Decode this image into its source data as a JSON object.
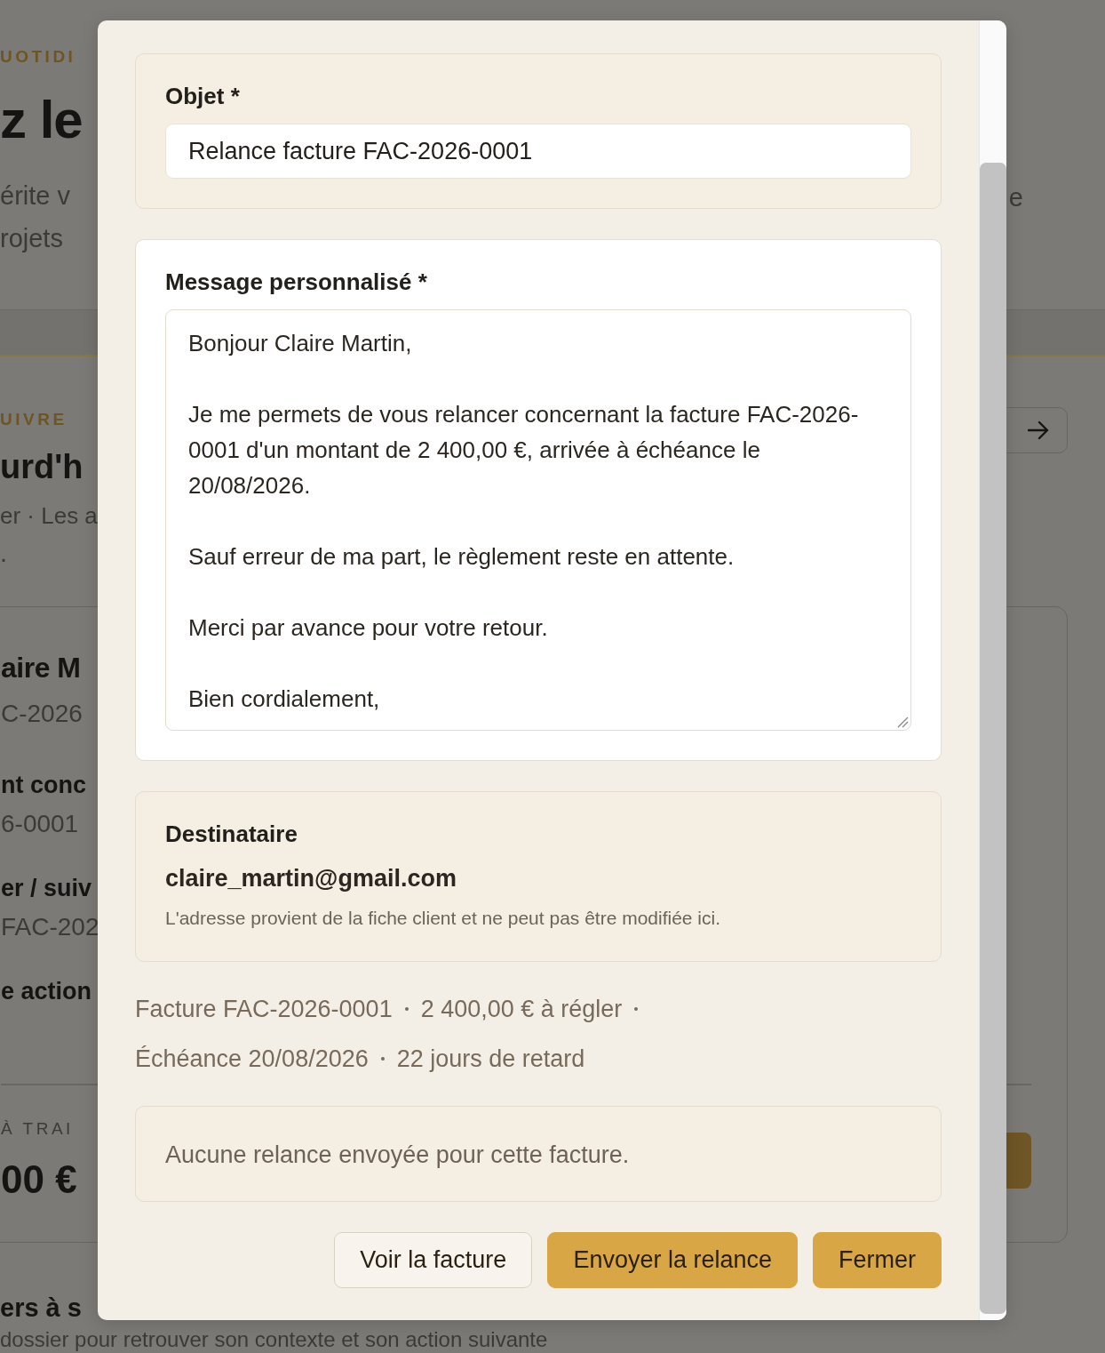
{
  "background": {
    "hero": {
      "eyebrow": "UOTIDI",
      "title": "z le",
      "lines": [
        "érite v",
        "rojets"
      ],
      "right_text": "e"
    },
    "section": {
      "eyebrow": "UIVRE",
      "title": "urd'h",
      "lines": [
        "er · Les a",
        "."
      ]
    },
    "card": {
      "items": [
        {
          "kind": "name",
          "text": "aire M"
        },
        {
          "kind": "sub",
          "text": "C-2026"
        },
        {
          "kind": "label",
          "text": "nt conc"
        },
        {
          "kind": "sub",
          "text": "6-0001"
        },
        {
          "kind": "label",
          "text": "er / suiv"
        },
        {
          "kind": "sub",
          "text": "FAC-202"
        },
        {
          "kind": "label",
          "text": "e action"
        }
      ],
      "eyebrow": "À TRAI",
      "amount": "00 €"
    },
    "footer": {
      "title": "ers à s",
      "line": "dossier pour retrouver son contexte et son action suivante"
    }
  },
  "dialog": {
    "subject": {
      "label": "Objet *",
      "value": "Relance facture FAC-2026-0001"
    },
    "message": {
      "label": "Message personnalisé *",
      "value": "Bonjour Claire Martin,\n\nJe me permets de vous relancer concernant la facture FAC-2026-0001 d'un montant de 2 400,00 €, arrivée à échéance le 20/08/2026.\n\nSauf erreur de ma part, le règlement reste en attente.\n\nMerci par avance pour votre retour.\n\nBien cordialement,"
    },
    "recipient": {
      "label": "Destinataire",
      "email": "claire_martin@gmail.com",
      "note": "L'adresse provient de la fiche client et ne peut pas être modifiée ici."
    },
    "summary": [
      "Facture FAC-2026-0001",
      "2 400,00 € à régler",
      "Échéance 20/08/2026",
      "22 jours de retard"
    ],
    "history": "Aucune relance envoyée pour cette facture.",
    "buttons": [
      {
        "label": "Voir la facture",
        "kind": "secondary"
      },
      {
        "label": "Envoyer la relance",
        "kind": "primary"
      },
      {
        "label": "Fermer",
        "kind": "primary"
      }
    ]
  }
}
